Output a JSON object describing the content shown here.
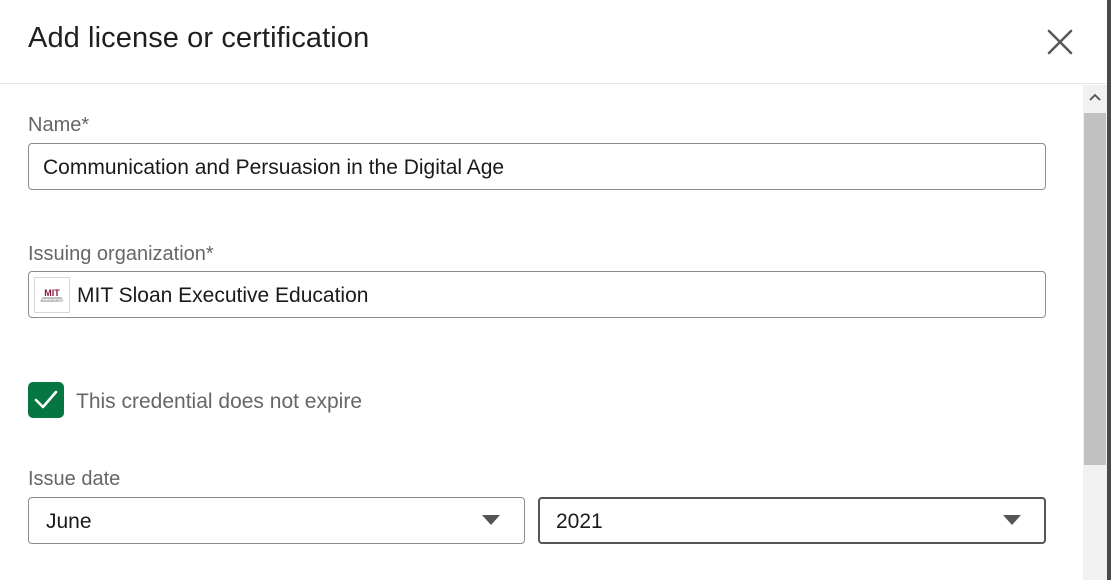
{
  "dialog": {
    "title": "Add license or certification",
    "close_icon": "close-icon"
  },
  "form": {
    "name": {
      "label": "Name*",
      "value": "Communication and Persuasion in the Digital Age"
    },
    "issuing_org": {
      "label": "Issuing organization*",
      "value": "MIT Sloan Executive Education",
      "logo_text": "MIT",
      "logo_subtext": "MANAGEMENT"
    },
    "no_expire": {
      "label": "This credential does not expire",
      "checked": true
    },
    "issue_date": {
      "label": "Issue date",
      "month": "June",
      "year": "2021"
    }
  },
  "colors": {
    "checkbox_green": "#057642",
    "border": "#8c8c8c",
    "label_gray": "#666666"
  }
}
